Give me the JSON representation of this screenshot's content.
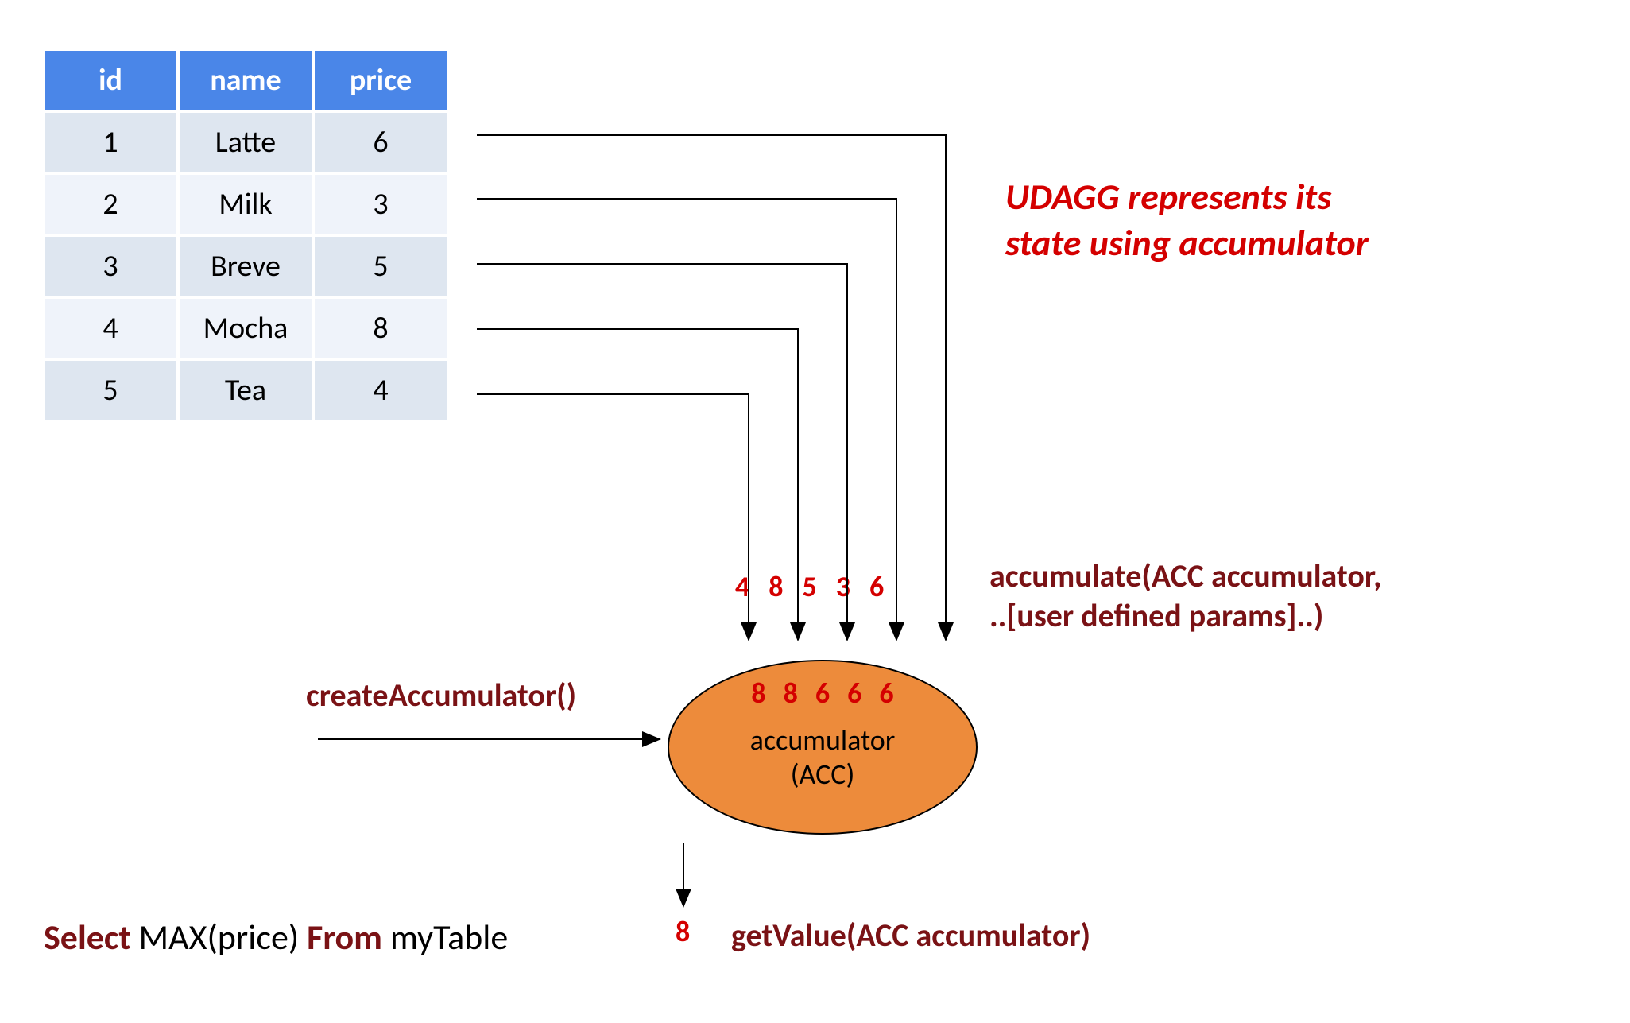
{
  "table": {
    "headers": [
      "id",
      "name",
      "price"
    ],
    "rows": [
      {
        "id": "1",
        "name": "Latte",
        "price": "6"
      },
      {
        "id": "2",
        "name": "Milk",
        "price": "3"
      },
      {
        "id": "3",
        "name": "Breve",
        "price": "5"
      },
      {
        "id": "4",
        "name": "Mocha",
        "price": "8"
      },
      {
        "id": "5",
        "name": "Tea",
        "price": "4"
      }
    ]
  },
  "caption": {
    "line1": "UDAGG represents its",
    "line2": "state using accumulator"
  },
  "labels": {
    "createAccumulator": "createAccumulator()",
    "accumulate_line1": "accumulate(ACC accumulator,",
    "accumulate_line2": "..[user defined params]..)",
    "getValue": "getValue(ACC accumulator)",
    "accumulator_label_line1": "accumulator",
    "accumulator_label_line2": "(ACC)"
  },
  "values": {
    "incoming": [
      "4",
      "8",
      "5",
      "3",
      "6"
    ],
    "inner": [
      "8",
      "8",
      "6",
      "6",
      "6"
    ],
    "output": "8"
  },
  "query": {
    "parts": [
      {
        "text": "Select ",
        "class": "darkred"
      },
      {
        "text": "MAX(price) ",
        "class": ""
      },
      {
        "text": "From ",
        "class": "darkred"
      },
      {
        "text": "myTable",
        "class": ""
      }
    ]
  }
}
